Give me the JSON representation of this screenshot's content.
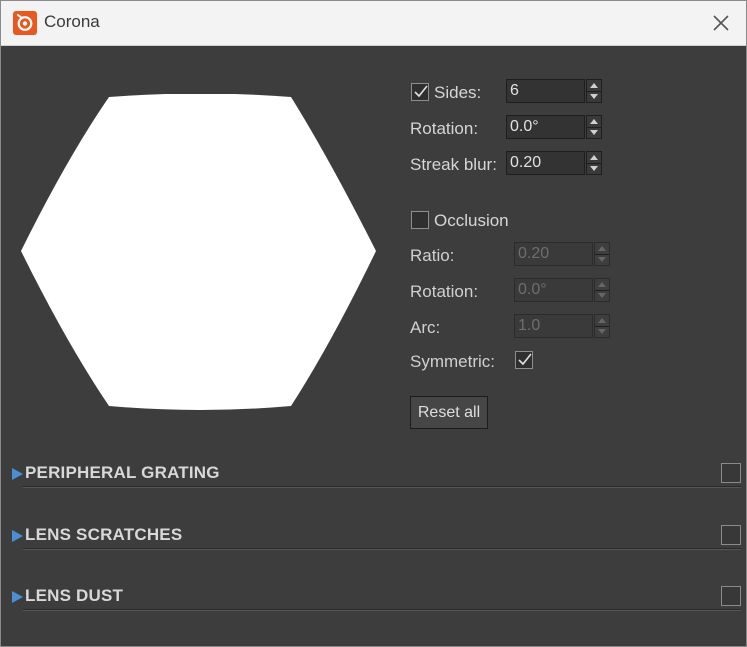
{
  "window": {
    "title": "Corona"
  },
  "bokeh": {
    "sides_checked": true,
    "sides_label": "Sides:",
    "sides_value": "6",
    "rotation_label": "Rotation:",
    "rotation_value": "0.0°",
    "streak_blur_label": "Streak blur:",
    "streak_blur_value": "0.20"
  },
  "occlusion": {
    "label": "Occlusion",
    "checked": false,
    "ratio_label": "Ratio:",
    "ratio_value": "0.20",
    "rotation_label": "Rotation:",
    "rotation_value": "0.0°",
    "arc_label": "Arc:",
    "arc_value": "1.0",
    "symmetric_label": "Symmetric:",
    "symmetric_checked": true
  },
  "reset_label": "Reset all",
  "sections": [
    {
      "title": "PERIPHERAL GRATING",
      "enabled": false
    },
    {
      "title": "LENS SCRATCHES",
      "enabled": false
    },
    {
      "title": "LENS DUST",
      "enabled": false
    }
  ],
  "colors": {
    "accent": "#4a8fd6",
    "brand": "#e8581f",
    "panel": "#3d3d3d"
  }
}
